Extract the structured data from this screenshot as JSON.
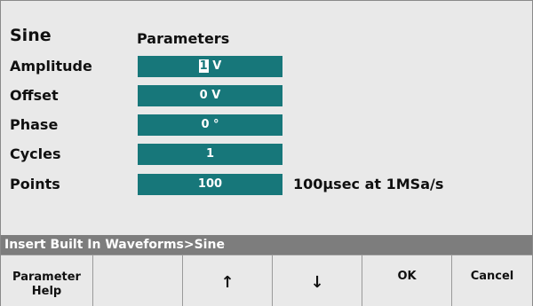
{
  "waveform": {
    "name": "Sine",
    "section_title": "Parameters"
  },
  "params": [
    {
      "label": "Amplitude",
      "value_cursor": "1",
      "value_rest": " V"
    },
    {
      "label": "Offset",
      "value": "0 V"
    },
    {
      "label": "Phase",
      "value": "0 °"
    },
    {
      "label": "Cycles",
      "value": "1"
    },
    {
      "label": "Points",
      "value": "100",
      "note": "100µsec at 1MSa/s"
    }
  ],
  "status_bar": {
    "text": "Insert Built In Waveforms>Sine"
  },
  "softkeys": {
    "parameter_help_line1": "Parameter",
    "parameter_help_line2": "Help",
    "up_arrow": "↑",
    "down_arrow": "↓",
    "ok": "OK",
    "cancel": "Cancel"
  },
  "colors": {
    "field_bg": "#17777a",
    "status_bg": "#7d7d7d",
    "screen_bg": "#e9e9e9"
  }
}
